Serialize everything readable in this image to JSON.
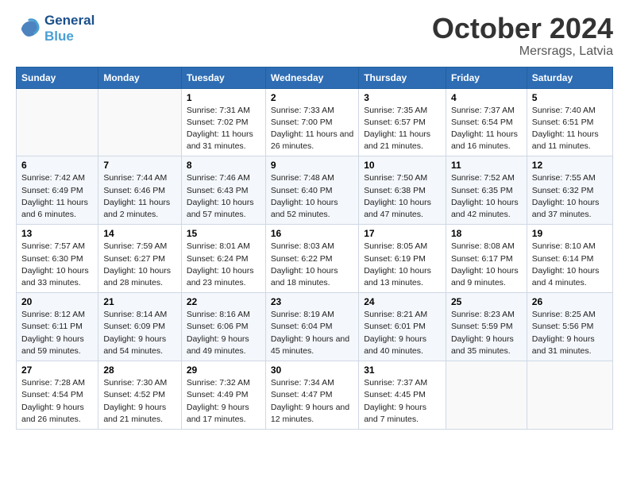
{
  "header": {
    "logo_line1": "General",
    "logo_line2": "Blue",
    "month": "October 2024",
    "location": "Mersrags, Latvia"
  },
  "columns": [
    "Sunday",
    "Monday",
    "Tuesday",
    "Wednesday",
    "Thursday",
    "Friday",
    "Saturday"
  ],
  "weeks": [
    [
      {
        "day": "",
        "sunrise": "",
        "sunset": "",
        "daylight": ""
      },
      {
        "day": "",
        "sunrise": "",
        "sunset": "",
        "daylight": ""
      },
      {
        "day": "1",
        "sunrise": "Sunrise: 7:31 AM",
        "sunset": "Sunset: 7:02 PM",
        "daylight": "Daylight: 11 hours and 31 minutes."
      },
      {
        "day": "2",
        "sunrise": "Sunrise: 7:33 AM",
        "sunset": "Sunset: 7:00 PM",
        "daylight": "Daylight: 11 hours and 26 minutes."
      },
      {
        "day": "3",
        "sunrise": "Sunrise: 7:35 AM",
        "sunset": "Sunset: 6:57 PM",
        "daylight": "Daylight: 11 hours and 21 minutes."
      },
      {
        "day": "4",
        "sunrise": "Sunrise: 7:37 AM",
        "sunset": "Sunset: 6:54 PM",
        "daylight": "Daylight: 11 hours and 16 minutes."
      },
      {
        "day": "5",
        "sunrise": "Sunrise: 7:40 AM",
        "sunset": "Sunset: 6:51 PM",
        "daylight": "Daylight: 11 hours and 11 minutes."
      }
    ],
    [
      {
        "day": "6",
        "sunrise": "Sunrise: 7:42 AM",
        "sunset": "Sunset: 6:49 PM",
        "daylight": "Daylight: 11 hours and 6 minutes."
      },
      {
        "day": "7",
        "sunrise": "Sunrise: 7:44 AM",
        "sunset": "Sunset: 6:46 PM",
        "daylight": "Daylight: 11 hours and 2 minutes."
      },
      {
        "day": "8",
        "sunrise": "Sunrise: 7:46 AM",
        "sunset": "Sunset: 6:43 PM",
        "daylight": "Daylight: 10 hours and 57 minutes."
      },
      {
        "day": "9",
        "sunrise": "Sunrise: 7:48 AM",
        "sunset": "Sunset: 6:40 PM",
        "daylight": "Daylight: 10 hours and 52 minutes."
      },
      {
        "day": "10",
        "sunrise": "Sunrise: 7:50 AM",
        "sunset": "Sunset: 6:38 PM",
        "daylight": "Daylight: 10 hours and 47 minutes."
      },
      {
        "day": "11",
        "sunrise": "Sunrise: 7:52 AM",
        "sunset": "Sunset: 6:35 PM",
        "daylight": "Daylight: 10 hours and 42 minutes."
      },
      {
        "day": "12",
        "sunrise": "Sunrise: 7:55 AM",
        "sunset": "Sunset: 6:32 PM",
        "daylight": "Daylight: 10 hours and 37 minutes."
      }
    ],
    [
      {
        "day": "13",
        "sunrise": "Sunrise: 7:57 AM",
        "sunset": "Sunset: 6:30 PM",
        "daylight": "Daylight: 10 hours and 33 minutes."
      },
      {
        "day": "14",
        "sunrise": "Sunrise: 7:59 AM",
        "sunset": "Sunset: 6:27 PM",
        "daylight": "Daylight: 10 hours and 28 minutes."
      },
      {
        "day": "15",
        "sunrise": "Sunrise: 8:01 AM",
        "sunset": "Sunset: 6:24 PM",
        "daylight": "Daylight: 10 hours and 23 minutes."
      },
      {
        "day": "16",
        "sunrise": "Sunrise: 8:03 AM",
        "sunset": "Sunset: 6:22 PM",
        "daylight": "Daylight: 10 hours and 18 minutes."
      },
      {
        "day": "17",
        "sunrise": "Sunrise: 8:05 AM",
        "sunset": "Sunset: 6:19 PM",
        "daylight": "Daylight: 10 hours and 13 minutes."
      },
      {
        "day": "18",
        "sunrise": "Sunrise: 8:08 AM",
        "sunset": "Sunset: 6:17 PM",
        "daylight": "Daylight: 10 hours and 9 minutes."
      },
      {
        "day": "19",
        "sunrise": "Sunrise: 8:10 AM",
        "sunset": "Sunset: 6:14 PM",
        "daylight": "Daylight: 10 hours and 4 minutes."
      }
    ],
    [
      {
        "day": "20",
        "sunrise": "Sunrise: 8:12 AM",
        "sunset": "Sunset: 6:11 PM",
        "daylight": "Daylight: 9 hours and 59 minutes."
      },
      {
        "day": "21",
        "sunrise": "Sunrise: 8:14 AM",
        "sunset": "Sunset: 6:09 PM",
        "daylight": "Daylight: 9 hours and 54 minutes."
      },
      {
        "day": "22",
        "sunrise": "Sunrise: 8:16 AM",
        "sunset": "Sunset: 6:06 PM",
        "daylight": "Daylight: 9 hours and 49 minutes."
      },
      {
        "day": "23",
        "sunrise": "Sunrise: 8:19 AM",
        "sunset": "Sunset: 6:04 PM",
        "daylight": "Daylight: 9 hours and 45 minutes."
      },
      {
        "day": "24",
        "sunrise": "Sunrise: 8:21 AM",
        "sunset": "Sunset: 6:01 PM",
        "daylight": "Daylight: 9 hours and 40 minutes."
      },
      {
        "day": "25",
        "sunrise": "Sunrise: 8:23 AM",
        "sunset": "Sunset: 5:59 PM",
        "daylight": "Daylight: 9 hours and 35 minutes."
      },
      {
        "day": "26",
        "sunrise": "Sunrise: 8:25 AM",
        "sunset": "Sunset: 5:56 PM",
        "daylight": "Daylight: 9 hours and 31 minutes."
      }
    ],
    [
      {
        "day": "27",
        "sunrise": "Sunrise: 7:28 AM",
        "sunset": "Sunset: 4:54 PM",
        "daylight": "Daylight: 9 hours and 26 minutes."
      },
      {
        "day": "28",
        "sunrise": "Sunrise: 7:30 AM",
        "sunset": "Sunset: 4:52 PM",
        "daylight": "Daylight: 9 hours and 21 minutes."
      },
      {
        "day": "29",
        "sunrise": "Sunrise: 7:32 AM",
        "sunset": "Sunset: 4:49 PM",
        "daylight": "Daylight: 9 hours and 17 minutes."
      },
      {
        "day": "30",
        "sunrise": "Sunrise: 7:34 AM",
        "sunset": "Sunset: 4:47 PM",
        "daylight": "Daylight: 9 hours and 12 minutes."
      },
      {
        "day": "31",
        "sunrise": "Sunrise: 7:37 AM",
        "sunset": "Sunset: 4:45 PM",
        "daylight": "Daylight: 9 hours and 7 minutes."
      },
      {
        "day": "",
        "sunrise": "",
        "sunset": "",
        "daylight": ""
      },
      {
        "day": "",
        "sunrise": "",
        "sunset": "",
        "daylight": ""
      }
    ]
  ]
}
